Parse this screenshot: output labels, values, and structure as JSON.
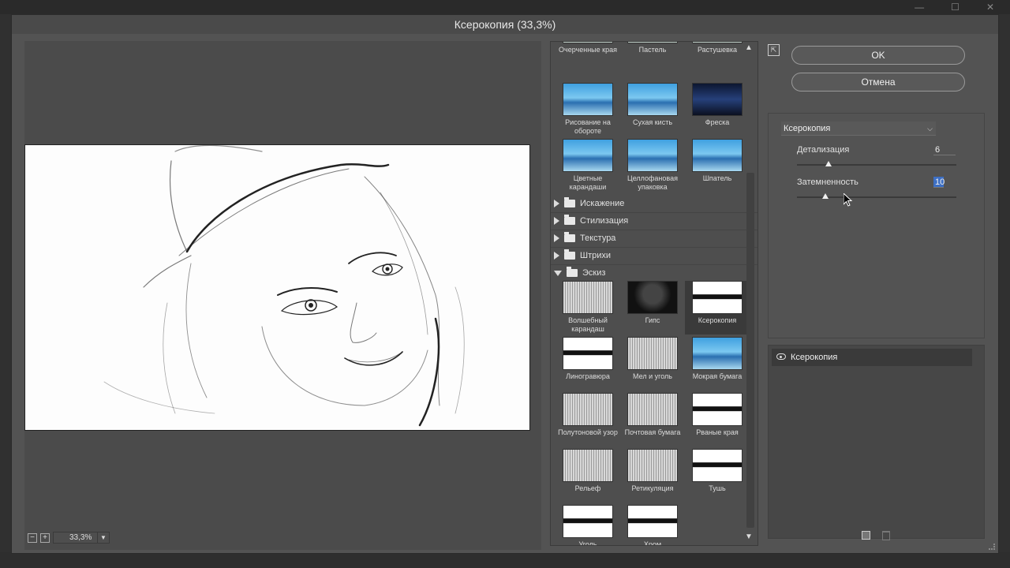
{
  "dialog": {
    "title": "Ксерокопия (33,3%)"
  },
  "preview": {
    "zoom": "33,3%",
    "zoom_out": "−",
    "zoom_in": "+"
  },
  "gallery": {
    "top_row": [
      "Очерченные края",
      "Пастель",
      "Растушевка"
    ],
    "artistic_rows": [
      [
        {
          "label": "Рисование на обороте",
          "style": "blue"
        },
        {
          "label": "Сухая кисть",
          "style": "blue"
        },
        {
          "label": "Фреска",
          "style": "dark"
        }
      ],
      [
        {
          "label": "Цветные карандаши",
          "style": "blue"
        },
        {
          "label": "Целлофановая упаковка",
          "style": "blue"
        },
        {
          "label": "Шпатель",
          "style": "blue"
        }
      ]
    ],
    "categories": [
      "Искажение",
      "Стилизация",
      "Текстура",
      "Штрихи"
    ],
    "open_category": "Эскиз",
    "sketch_rows": [
      [
        {
          "label": "Волшебный карандаш",
          "style": "sketch"
        },
        {
          "label": "Гипс",
          "style": "plaster"
        },
        {
          "label": "Ксерокопия",
          "style": "bw",
          "selected": true
        }
      ],
      [
        {
          "label": "Линогравюра",
          "style": "bw"
        },
        {
          "label": "Мел и уголь",
          "style": "sketch"
        },
        {
          "label": "Мокрая бумага",
          "style": "blue"
        }
      ],
      [
        {
          "label": "Полутоновой узор",
          "style": "sketch"
        },
        {
          "label": "Почтовая бумага",
          "style": "sketch"
        },
        {
          "label": "Рваные края",
          "style": "bw"
        }
      ],
      [
        {
          "label": "Рельеф",
          "style": "sketch"
        },
        {
          "label": "Ретикуляция",
          "style": "sketch"
        },
        {
          "label": "Тушь",
          "style": "bw"
        }
      ],
      [
        {
          "label": "Уголь",
          "style": "bw"
        },
        {
          "label": "Хром",
          "style": "bw"
        }
      ]
    ]
  },
  "buttons": {
    "ok": "OK",
    "cancel": "Отмена"
  },
  "settings": {
    "filter": "Ксерокопия",
    "params": [
      {
        "label": "Детализация",
        "value": "6",
        "level": 0.2
      },
      {
        "label": "Затемненность",
        "value": "10",
        "level": 0.18
      }
    ]
  },
  "layers": {
    "items": [
      "Ксерокопия"
    ]
  },
  "icons": {
    "collapse": "collapse-panel-icon",
    "eye": "eye-icon",
    "new_layer": "new-effect-layer-icon",
    "delete": "trash-icon",
    "folder": "folder-icon"
  },
  "colors": {
    "accent": "#3d6fc4",
    "dialog_bg": "#535353"
  }
}
